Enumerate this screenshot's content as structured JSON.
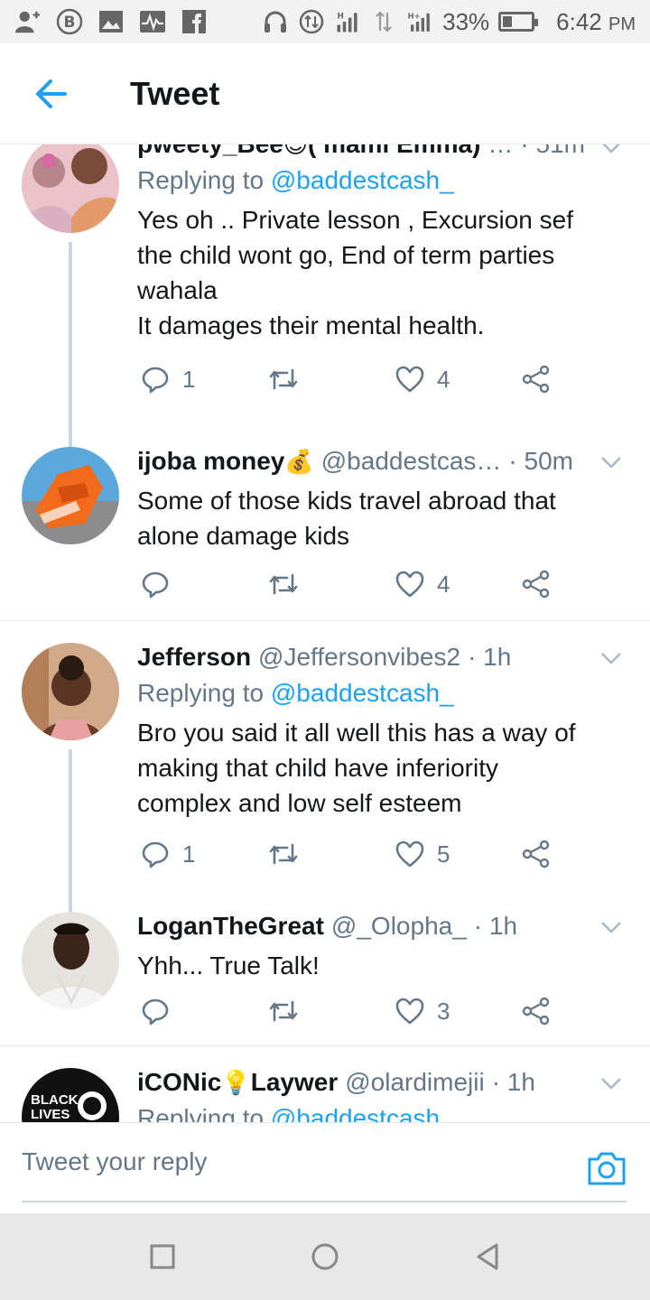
{
  "status_bar": {
    "battery_percent": "33%",
    "battery_level": 0.33,
    "time": "6:42",
    "ampm": "PM",
    "icons": [
      "add-person-icon",
      "b-circle-icon",
      "image-icon",
      "pulse-icon",
      "facebook-icon",
      "headphones-icon",
      "sync-icon",
      "signal-h-icon",
      "data-arrows-icon",
      "signal-hplus-icon",
      "battery-icon"
    ]
  },
  "header": {
    "title": "Tweet",
    "back_icon": "back-arrow-icon"
  },
  "colors": {
    "accent": "#1da1f2",
    "text": "#14171a",
    "muted": "#657786",
    "divider": "#e1e8ed"
  },
  "tweets": [
    {
      "name": "pweety_Bee",
      "name_emoji": "😍",
      "name_suffix": "( mami Emma)",
      "handle": "…",
      "time": "· 51m",
      "reply_prefix": "Replying to",
      "reply_to": "@baddestcash_",
      "lines": [
        "Yes oh .. Private lesson , Excursion sef",
        "the child wont go, End of term parties",
        "wahala",
        "It damages their mental health."
      ],
      "replies": "1",
      "retweets": "",
      "likes": "4"
    },
    {
      "name": "ijoba money",
      "name_emoji": "💰",
      "name_suffix": "",
      "handle": "@baddestcas…",
      "time": "· 50m",
      "reply_prefix": "",
      "reply_to": "",
      "lines": [
        "Some of those kids travel abroad that",
        "alone damage kids"
      ],
      "replies": "",
      "retweets": "",
      "likes": "4"
    },
    {
      "name": "Jefferson",
      "name_emoji": "",
      "name_suffix": "",
      "handle": "@Jeffersonvibes2",
      "time": "· 1h",
      "reply_prefix": "Replying to",
      "reply_to": "@baddestcash_",
      "lines": [
        "Bro you said it all well this has a way of",
        "making that child have inferiority",
        "complex and low self esteem"
      ],
      "replies": "1",
      "retweets": "",
      "likes": "5"
    },
    {
      "name": "LoganTheGreat",
      "name_emoji": "",
      "name_suffix": "",
      "handle": "@_Olopha_",
      "time": "· 1h",
      "reply_prefix": "",
      "reply_to": "",
      "lines": [
        "Yhh... True Talk!"
      ],
      "replies": "",
      "retweets": "",
      "likes": "3"
    },
    {
      "name": "iCONic",
      "name_emoji": "💡",
      "name_suffix": "Laywer",
      "handle": "@olardimejii",
      "time": "· 1h",
      "reply_prefix": "Replying to",
      "reply_to": "@baddestcash",
      "avatar_text_1": "BLACK",
      "avatar_text_2": "LIVES"
    }
  ],
  "compose": {
    "placeholder": "Tweet your reply",
    "camera_icon": "camera-icon"
  },
  "navbar": {
    "icons": [
      "recents-square-icon",
      "home-circle-icon",
      "back-triangle-icon"
    ]
  }
}
